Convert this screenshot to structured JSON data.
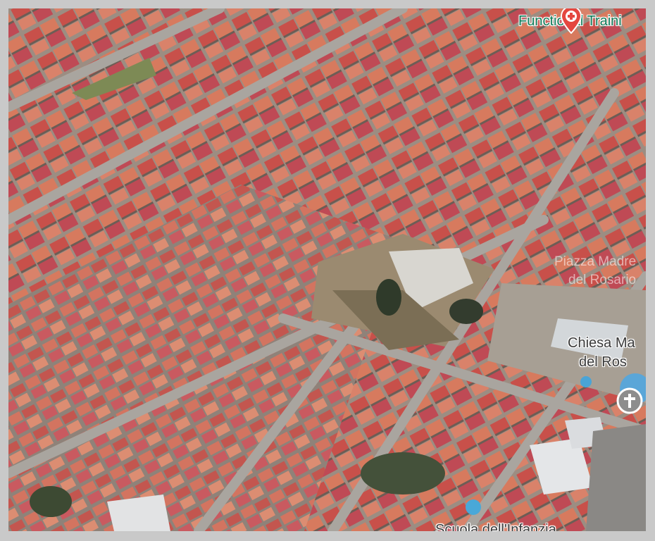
{
  "map": {
    "view": "satellite-3d",
    "colors": {
      "roof_red": "#c8504a",
      "roof_orange": "#d77a5e",
      "road": "#a7a39d",
      "green_label": "#0f7a57",
      "pin_red": "#e4473f",
      "pin_gray": "#8d8d8d"
    },
    "labels": {
      "poi_top": "Functional Traini",
      "square": "Piazza Madre",
      "square_line2": "del Rosario",
      "church_line1": "Chiesa Ma",
      "church_line2": "del Ros",
      "school": "Scuola dell'Infanzia"
    },
    "icons": {
      "poi_top": "medical-cross-pin-icon",
      "church": "cross-pin-icon"
    }
  }
}
